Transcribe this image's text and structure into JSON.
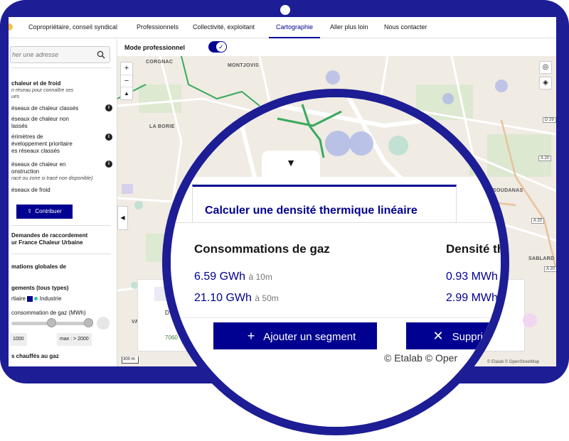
{
  "nav": {
    "items": [
      "Copropriétaire, conseil syndical",
      "Professionnels",
      "Collectivité, exploitant",
      "Cartographie",
      "Aller plus loin",
      "Nous contacter"
    ],
    "active": "Cartographie"
  },
  "sidebar": {
    "search_placeholder": "her une adresse",
    "section_title": "chaleur et de froid",
    "section_hint_1": "n réseau pour connaître ses",
    "section_hint_2": "ues",
    "layers": [
      {
        "line1": "éseaux de chaleur classés",
        "line2": ""
      },
      {
        "line1": "éseaux de chaleur non",
        "line2": "lassés"
      },
      {
        "line1": "érimètres de",
        "line2": "éveloppement prioritaire",
        "line3": "es réseaux classés"
      },
      {
        "line1": "éseaux de chaleur en",
        "line2": "onstruction",
        "line3": "racé ou zone si tracé non disponible)"
      },
      {
        "line1": "éseaux de froid",
        "line2": ""
      }
    ],
    "contribute_button": "Contribuer",
    "demands_line1": "Demandes de raccordement",
    "demands_line2": "ur France Chaleur Urbaine",
    "consumption_title": "mations globales de",
    "housing_label": "gements (tous types)",
    "tertiary_label": "rtiaire",
    "industry_label": "Industrie",
    "gas_consumption_label": "consommation de gaz (MWh)",
    "min_value": "1000",
    "max_value": "max : > 2000",
    "gas_heated_label": "s chauffés au gaz"
  },
  "map": {
    "mode_label": "Mode professionnel",
    "places": [
      "CORGNAC",
      "MONTJOVIS",
      "LA BORIE",
      "SOUDANAS",
      "SABLARD",
      "VANTE"
    ],
    "roads": [
      "D 29",
      "A 20",
      "A 20",
      "A 20"
    ],
    "scale": "300 m",
    "attribution": "© Etalab © OpenStreetMap",
    "under_labels": [
      "D",
      "7060"
    ]
  },
  "panel": {
    "tab_title": "Calculer une densité thermique linéaire",
    "col1_title": "Consommations de gaz",
    "col2_title": "Densité th",
    "gas_values": [
      {
        "value": "6.59 GWh",
        "distance": "à 10m"
      },
      {
        "value": "21.10 GWh",
        "distance": "à 50m"
      }
    ],
    "density_values": [
      "0.93 MWh",
      "2.99 MWh"
    ],
    "add_segment_button": "Ajouter un segment",
    "delete_button": "Supprim",
    "attribution": "© Etalab © Oper"
  },
  "colors": {
    "frame": "#1d1d95",
    "primary": "#000091",
    "map_background": "#f0ebe3"
  }
}
